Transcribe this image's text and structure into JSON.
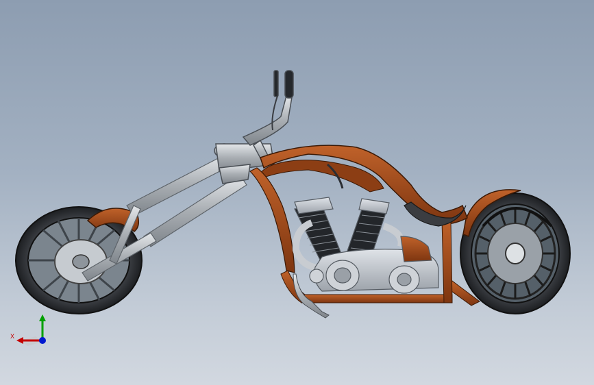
{
  "viewport": {
    "background_top": "#8d9db1",
    "background_bottom": "#d2d8e0"
  },
  "model": {
    "frame_color": "#a4511c",
    "chrome_color": "#a9aeb3",
    "engine_color": "#b9bec6",
    "tire_color": "#2a2c30"
  },
  "triad": {
    "x_label": "X",
    "x_color": "#c40000",
    "y_color": "#00a000",
    "z_color": "#0018d0"
  }
}
